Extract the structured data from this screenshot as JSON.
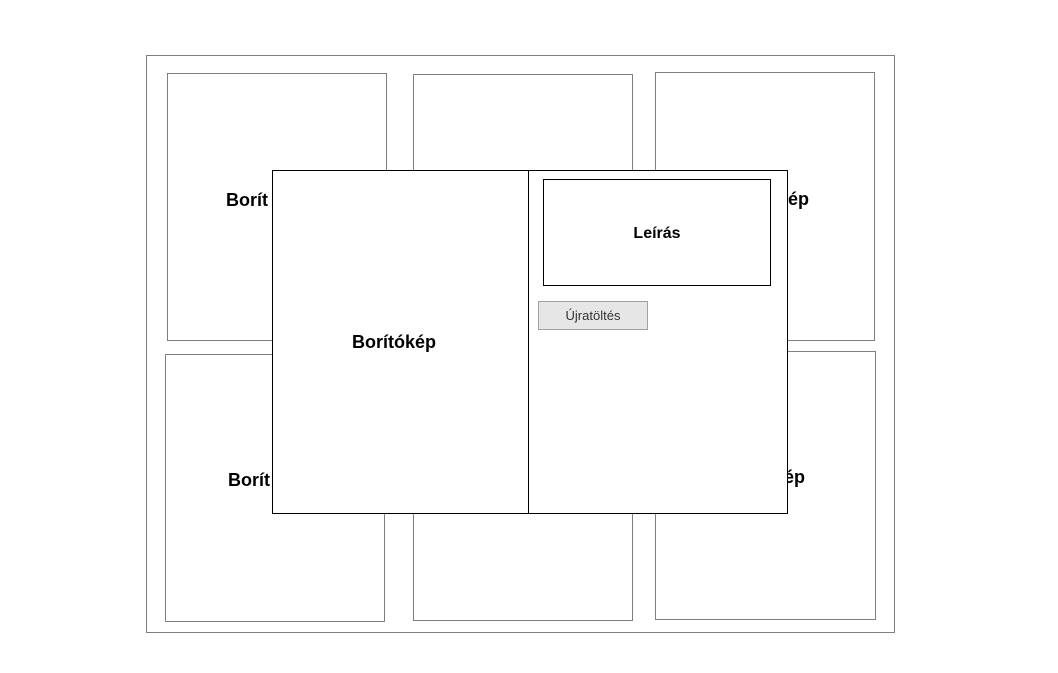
{
  "cards": [
    {
      "label": "Borít"
    },
    {
      "label": ""
    },
    {
      "label": "ép"
    },
    {
      "label": "Borít"
    },
    {
      "label": ""
    },
    {
      "label": "kép"
    }
  ],
  "modal": {
    "cover_label": "Borítókép",
    "description_label": "Leírás",
    "reload_button_label": "Újratöltés"
  }
}
